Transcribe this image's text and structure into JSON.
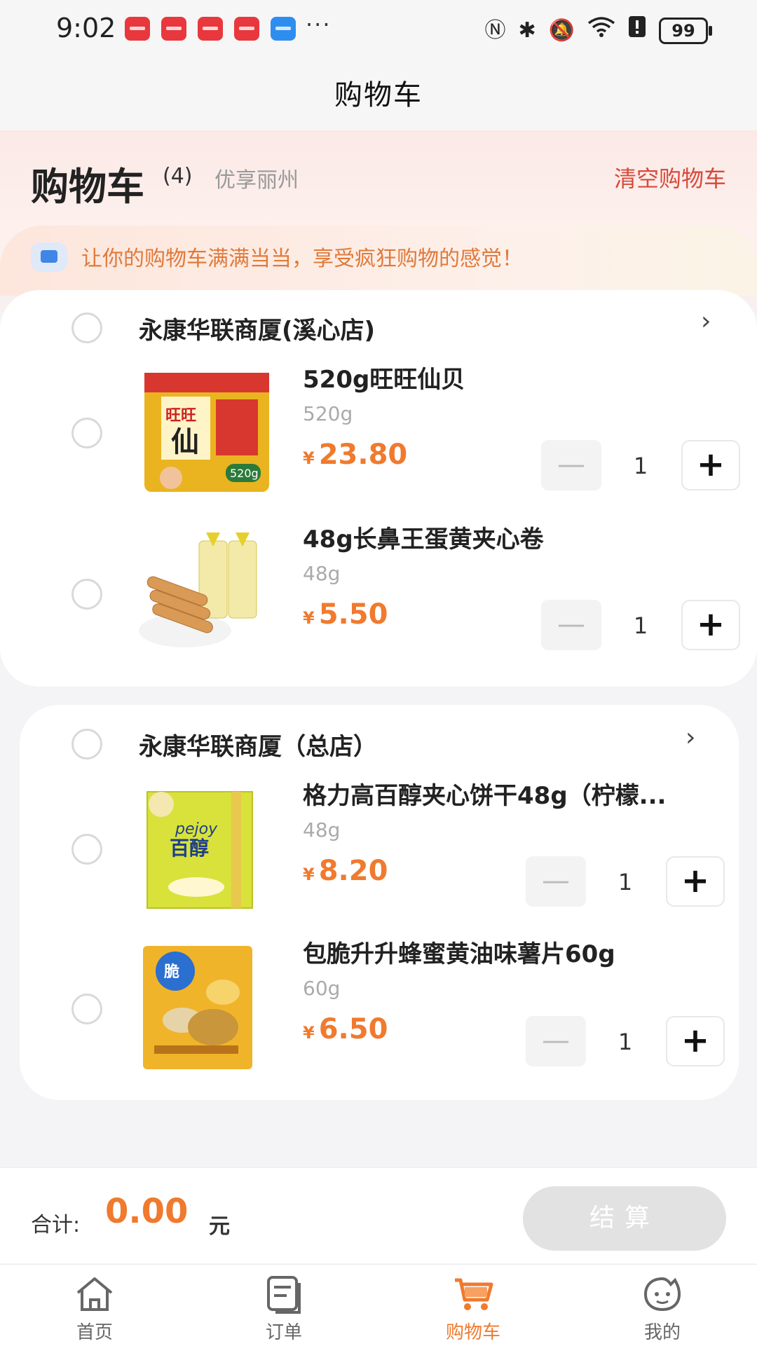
{
  "status_bar": {
    "time": "9:02",
    "more": "···",
    "battery": "99"
  },
  "nav": {
    "title": "购物车"
  },
  "header": {
    "title": "购物车",
    "count": "(4)",
    "location": "优享丽州",
    "clear_label": "清空购物车"
  },
  "notice": {
    "text": "让你的购物车满满当当，享受疯狂购物的感觉！"
  },
  "stores": [
    {
      "name": "永康华联商厦(溪心店)",
      "items": [
        {
          "name": "520g旺旺仙贝",
          "spec": "520g",
          "currency": "¥",
          "price": "23.80",
          "qty": "1"
        },
        {
          "name": "48g长鼻王蛋黄夹心卷",
          "spec": "48g",
          "currency": "¥",
          "price": "5.50",
          "qty": "1"
        }
      ]
    },
    {
      "name": "永康华联商厦（总店）",
      "items": [
        {
          "name": "格力高百醇夹心饼干48g（柠檬...",
          "spec": "48g",
          "currency": "¥",
          "price": "8.20",
          "qty": "1"
        },
        {
          "name": "包脆升升蜂蜜黄油味薯片60g",
          "spec": "60g",
          "currency": "¥",
          "price": "6.50",
          "qty": "1"
        }
      ]
    }
  ],
  "stepper": {
    "minus": "—",
    "plus": "+"
  },
  "total": {
    "label": "合计:",
    "amount": "0.00",
    "unit": "元",
    "checkout_label": "结算"
  },
  "tabs": [
    {
      "label": "首页",
      "icon": "home-icon"
    },
    {
      "label": "订单",
      "icon": "orders-icon"
    },
    {
      "label": "购物车",
      "icon": "cart-icon",
      "active": true
    },
    {
      "label": "我的",
      "icon": "profile-icon"
    }
  ],
  "colors": {
    "accent": "#f07a2e",
    "clear": "#d64a3b",
    "checkout_disabled": "#e2e2e2"
  }
}
